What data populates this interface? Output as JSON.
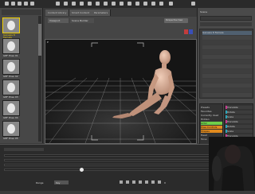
{
  "tabs": [
    "Content Library",
    "Smart Content",
    "Parameters"
  ],
  "viewport_tabs": [
    "Viewport",
    "Scene Builder"
  ],
  "viewport": {
    "camera_label": "Perspective View",
    "letter": "P"
  },
  "library_items": [
    {
      "label": "Genesis 8 Female",
      "selected": true
    },
    {
      "label": "G8F Pose 01",
      "selected": false
    },
    {
      "label": "G8F Pose 02",
      "selected": false
    },
    {
      "label": "G8F Pose 03",
      "selected": false
    },
    {
      "label": "G8F Pose 04",
      "selected": false
    },
    {
      "label": "G8F Pose 05",
      "selected": false
    }
  ],
  "right_header": "Scene",
  "scene_rows": [
    "Genesis 8 Female",
    "",
    "",
    "",
    "",
    "",
    "",
    "",
    "",
    "",
    "",
    "",
    "",
    ""
  ],
  "groups_left": [
    "Presets",
    "Favorites",
    "Currently Used",
    "Hidden",
    "Actor",
    "Pose Controls",
    "Shapes",
    "Head",
    "Torso"
  ],
  "groups_right": [
    "Translate",
    "Rotate",
    "Scale",
    "Translate",
    "Rotate",
    "Scale",
    "Translate",
    "Rotate"
  ],
  "timeline": {
    "mode_label": "Range",
    "mode_value": "Key",
    "frame": "0"
  },
  "colors": {
    "accent": "#f2d100",
    "green": "#6fcf4a",
    "orange": "#e08a1e",
    "magenta": "#c73a8f",
    "teal": "#2aa4b8"
  }
}
